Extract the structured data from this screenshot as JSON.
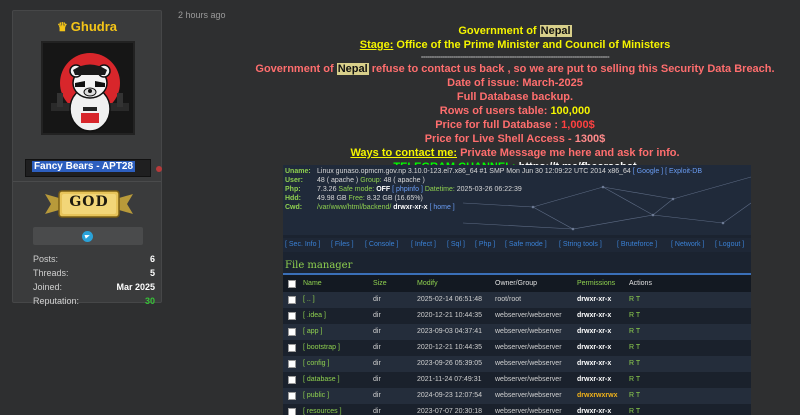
{
  "user": {
    "name": "Ghudra",
    "title": "Fancy Bears - APT28",
    "rank": "GOD",
    "stats": [
      {
        "label": "Posts:",
        "value": "6"
      },
      {
        "label": "Threads:",
        "value": "5"
      },
      {
        "label": "Joined:",
        "value": "Mar 2025"
      },
      {
        "label": "Reputation:",
        "value": "30"
      }
    ]
  },
  "post": {
    "timestamp": "2 hours ago",
    "line1_prefix": "Government of",
    "line1_hl": "Nepal",
    "stage_label": "Stage:",
    "stage_text": "Office of the Prime Minister and Council of Ministers",
    "dashes": "---------------------------------------------------------------------------------------",
    "line3_prefix": "Government of",
    "line3_hl": "Nepal",
    "line3_rest": "refuse to contact us back , so we are put to selling this Security Data Breach.",
    "issue_date": "Date of issue: March-2025",
    "backup": "Full Database backup.",
    "rows_label": "Rows of users table:",
    "rows_value": "100,000",
    "price_full_label": "Price for full Database :",
    "price_full_value": "1,000$",
    "price_shell_label": "Price for Live Shell Access -",
    "price_shell_value": "1300$",
    "contact_label": "Ways to contact me:",
    "contact_text": "Private Message me here and ask for info.",
    "telegram_label": "TELEGRAM CHANNEL:",
    "telegram_link": "https://t.me/fbearschat"
  },
  "shell": {
    "sys": {
      "uname_k": "Uname:",
      "uname_v": "Linux gunaso.opmcm.gov.np 3.10.0-123.el7.x86_64 #1 SMP Mon Jun 30 12:09:22 UTC 2014 x86_64",
      "uname_link1": "[ Google ]",
      "uname_link2": "[ Exploit-DB",
      "user_k": "User:",
      "user_v1": "48 ( apache )",
      "user_g": "Group:",
      "user_v2": "48 ( apache )",
      "php_k": "Php:",
      "php_v1": "7.3.26",
      "php_safe": "Safe mode:",
      "php_off": "OFF",
      "php_info": "[ phpinfo ]",
      "php_dt": "Datetime:",
      "php_dtv": "2025-03-26 06:22:39",
      "hdd_k": "Hdd:",
      "hdd_v1": "49.98 GB",
      "hdd_free": "Free:",
      "hdd_v2": "8.32 GB (16.65%)",
      "cwd_k": "Cwd:",
      "cwd_v": "/var/www/html/backend/",
      "cwd_perm": "drwxr-xr-x",
      "cwd_home": "[ home ]"
    },
    "nav": [
      "[ Sec. Info ]",
      "[ Files ]",
      "[ Console ]",
      "[ Infect ]",
      "[ Sql ]",
      "[ Php ]",
      "[ Safe mode ]",
      "[ String tools ]",
      "[ Bruteforce ]",
      "[ Network ]",
      "[ Logout ]"
    ],
    "fm_title": "File manager",
    "headers": {
      "name": "Name",
      "size": "Size",
      "modify": "Modify",
      "owner": "Owner/Group",
      "perm": "Permissions",
      "actions": "Actions"
    },
    "rows": [
      {
        "name": "[ .. ]",
        "size": "dir",
        "modify": "2025-02-14 06:51:48",
        "owner": "root/root",
        "perm": "drwxr-xr-x",
        "actions": "R T"
      },
      {
        "name": "[ .idea ]",
        "size": "dir",
        "modify": "2020-12-21 10:44:35",
        "owner": "webserver/webserver",
        "perm": "drwxr-xr-x",
        "actions": "R T"
      },
      {
        "name": "[ app ]",
        "size": "dir",
        "modify": "2023-09-03 04:37:41",
        "owner": "webserver/webserver",
        "perm": "drwxr-xr-x",
        "actions": "R T"
      },
      {
        "name": "[ bootstrap ]",
        "size": "dir",
        "modify": "2020-12-21 10:44:35",
        "owner": "webserver/webserver",
        "perm": "drwxr-xr-x",
        "actions": "R T"
      },
      {
        "name": "[ config ]",
        "size": "dir",
        "modify": "2023-09-26 05:39:05",
        "owner": "webserver/webserver",
        "perm": "drwxr-xr-x",
        "actions": "R T"
      },
      {
        "name": "[ database ]",
        "size": "dir",
        "modify": "2021-11-24 07:49:31",
        "owner": "webserver/webserver",
        "perm": "drwxr-xr-x",
        "actions": "R T"
      },
      {
        "name": "[ public ]",
        "size": "dir",
        "modify": "2024-09-23 12:07:54",
        "owner": "webserver/webserver",
        "perm": "drwxrwxrwx",
        "actions": "R T"
      },
      {
        "name": "[ resources ]",
        "size": "dir",
        "modify": "2023-07-07 20:30:18",
        "owner": "webserver/webserver",
        "perm": "drwxr-xr-x",
        "actions": "R T"
      }
    ]
  },
  "colors": {
    "accent_green": "#8fd14f",
    "warning_orange": "#f2b31a",
    "name_gold": "#f5c518",
    "rep_green": "#37c237"
  }
}
